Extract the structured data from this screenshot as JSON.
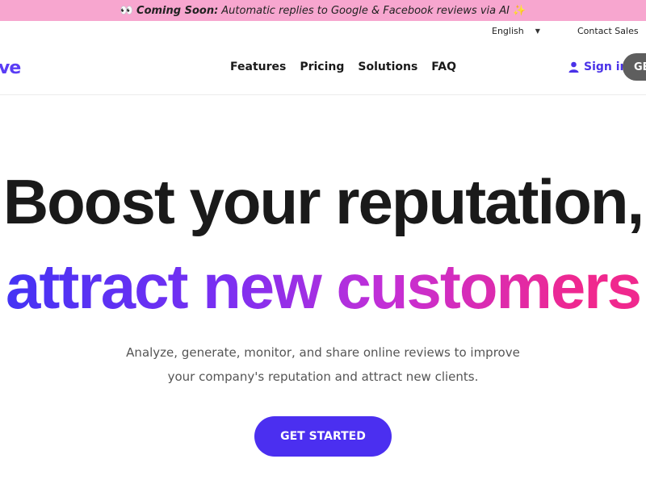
{
  "announcement": {
    "emoji_left": "👀",
    "label": "Coming Soon:",
    "text": "Automatic replies to Google & Facebook reviews via AI",
    "emoji_right": "✨"
  },
  "utility": {
    "language": "English",
    "contact": "Contact Sales"
  },
  "nav": {
    "logo_fragment": "ve",
    "links": [
      "Features",
      "Pricing",
      "Solutions",
      "FAQ"
    ],
    "signin": "Sign in",
    "cta_partial": "GE"
  },
  "hero": {
    "line1": "Boost your reputation,",
    "line2": "attract new customers",
    "subtitle_line1": "Analyze, generate, monitor, and share online reviews to improve",
    "subtitle_line2": "your company's reputation and attract new clients.",
    "cta": "GET STARTED"
  },
  "colors": {
    "announcement_bg": "#f7a6cf",
    "brand": "#4b2ff0",
    "gradient_start": "#4333f4",
    "gradient_end": "#f0288e"
  }
}
